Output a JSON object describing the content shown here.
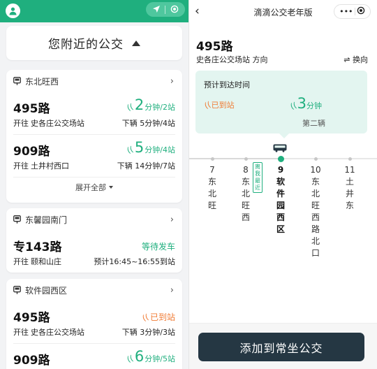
{
  "colors": {
    "brand_green": "#1faf7e",
    "arrived_orange": "#f07a33",
    "button_dark": "#253743",
    "eta_box_bg": "#e3f5f0"
  },
  "left": {
    "header_icons": [
      "avatar-icon",
      "locate-arrow-icon",
      "target-icon"
    ],
    "nearby_title": "您附近的公交",
    "stops": [
      {
        "name": "东北旺西",
        "routes": [
          {
            "route": "495路",
            "dir_prefix": "开往",
            "dir": "史各庄公交场站",
            "eta_num": "2",
            "eta_unit": "分钟/2站",
            "next": "下辆 5分钟/4站"
          },
          {
            "route": "909路",
            "dir_prefix": "开往",
            "dir": "土井村西口",
            "eta_num": "5",
            "eta_unit": "分钟/4站",
            "next": "下辆 14分钟/7站"
          }
        ],
        "expand_label": "展开全部"
      },
      {
        "name": "东馨园南门",
        "routes": [
          {
            "route": "专143路",
            "dir_prefix": "开往",
            "dir": "颐和山庄",
            "status": "等待发车",
            "next": "预计16:45~16:55到站"
          }
        ]
      },
      {
        "name": "软件园西区",
        "routes": [
          {
            "route": "495路",
            "dir_prefix": "开往",
            "dir": "史各庄公交场站",
            "status": "已到站",
            "next": "下辆 3分钟/3站"
          },
          {
            "route": "909路",
            "eta_num": "6",
            "eta_unit": "分钟/5站"
          }
        ]
      }
    ]
  },
  "right": {
    "title": "滴滴公交老年版",
    "capsule_more": "•••",
    "route": "495路",
    "direction": "史各庄公交场站 方向",
    "switch_label": "⇌ 换向",
    "eta_label": "预计到达时间",
    "arrived": "已到站",
    "eta_num": "3",
    "eta_unit": "分钟",
    "second_bus": "第二辆",
    "nearest_tag": "离我最近",
    "stops": [
      {
        "num": "7",
        "chars": [
          "东",
          "北",
          "旺"
        ]
      },
      {
        "num": "8",
        "chars": [
          "东",
          "北",
          "旺",
          "西"
        ]
      },
      {
        "num": "9",
        "chars": [
          "软",
          "件",
          "园",
          "西",
          "区"
        ],
        "current": true
      },
      {
        "num": "10",
        "chars": [
          "东",
          "北",
          "旺",
          "西",
          "路",
          "北",
          "口"
        ]
      },
      {
        "num": "11",
        "chars": [
          "土",
          "井",
          "东"
        ]
      }
    ],
    "add_button": "添加到常坐公交"
  }
}
